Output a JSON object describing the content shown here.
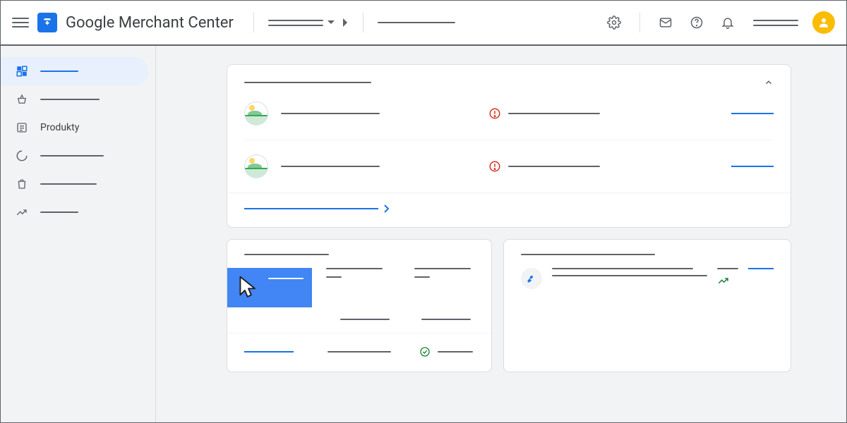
{
  "header": {
    "app_title": "Google Merchant Center",
    "account_selector": "",
    "search_placeholder": ""
  },
  "sidebar": {
    "items": [
      {
        "label": "",
        "icon": "dashboard",
        "active": true
      },
      {
        "label": "",
        "icon": "basket"
      },
      {
        "label": "Produkty",
        "icon": "list"
      },
      {
        "label": "",
        "icon": "spinner"
      },
      {
        "label": "",
        "icon": "bag"
      },
      {
        "label": "",
        "icon": "trend"
      }
    ]
  },
  "main": {
    "card1": {
      "title": "",
      "items": [
        {
          "name": "",
          "status_text": "",
          "status": "error",
          "link": ""
        },
        {
          "name": "",
          "status_text": "",
          "status": "error",
          "link": ""
        }
      ],
      "footer_link": ""
    },
    "card2": {
      "title": "",
      "metrics": [
        {
          "label": "",
          "value": ""
        },
        {
          "label": "",
          "value": ""
        },
        {
          "label": "",
          "value": ""
        }
      ],
      "bottom": [
        {
          "text": "",
          "kind": "link"
        },
        {
          "text": "",
          "kind": "text"
        },
        {
          "text": "",
          "kind": "ok"
        }
      ]
    },
    "card3": {
      "title": "",
      "recommendation": {
        "line1": "",
        "line2": ""
      },
      "side_text": "",
      "link": ""
    }
  }
}
